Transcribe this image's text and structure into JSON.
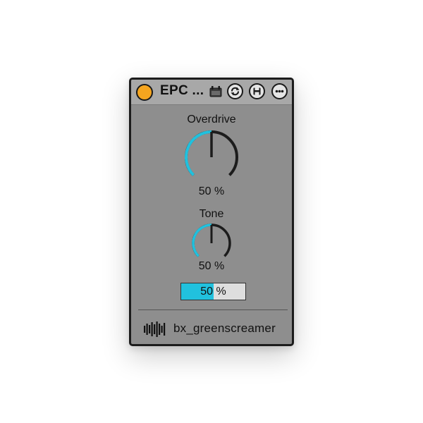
{
  "device": {
    "title": "EPC ...",
    "power_on": true,
    "colors": {
      "power": "#f5a51f",
      "accent": "#21c1de",
      "panel": "#8e8e8e",
      "titlebar": "#a8a8a8"
    }
  },
  "titlebar": {
    "icons": [
      "midi-map-icon",
      "refresh-icon",
      "save-icon",
      "more-icon"
    ]
  },
  "controls": {
    "overdrive": {
      "label": "Overdrive",
      "value": 0.5,
      "display": "50 %"
    },
    "tone": {
      "label": "Tone",
      "value": 0.5,
      "display": "50 %"
    },
    "mix": {
      "value": 0.5,
      "display": "50 %"
    }
  },
  "footer": {
    "plugin_name": "bx_greenscreamer",
    "icon": "plugin-waveform-icon"
  }
}
